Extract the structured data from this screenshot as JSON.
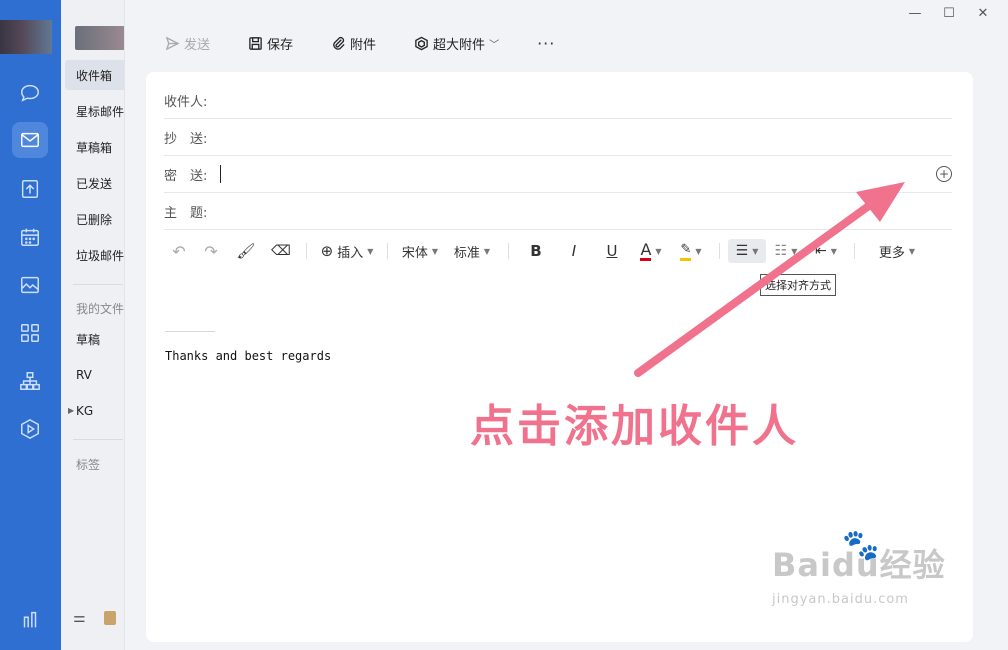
{
  "folders": {
    "items": [
      "收件箱",
      "星标邮件",
      "草稿箱",
      "已发送",
      "已删除",
      "垃圾邮件"
    ],
    "my_files_label": "我的文件",
    "file_items": [
      "草稿",
      "RV",
      "KG"
    ],
    "tags_label": "标签"
  },
  "toolbar": {
    "send_label": "发送",
    "save_label": "保存",
    "attach_label": "附件",
    "large_attach_label": "超大附件",
    "more_label": "···"
  },
  "fields": {
    "to_label": "收件人:",
    "cc_label": "抄　送:",
    "bcc_label": "密　送:",
    "subject_label": "主　题:"
  },
  "format_bar": {
    "insert_label": "插入",
    "font_label": "宋体",
    "size_label": "标准",
    "more_label": "更多",
    "align_tooltip": "选择对齐方式",
    "font_color": "#d9001b",
    "highlight_color": "#f5c400"
  },
  "body": {
    "signature": "Thanks and best regards"
  },
  "annotation": {
    "text": "点击添加收件人",
    "color": "#f0728d"
  },
  "watermark": {
    "brand": "Baidu经验",
    "url": "jingyan.baidu.com"
  }
}
